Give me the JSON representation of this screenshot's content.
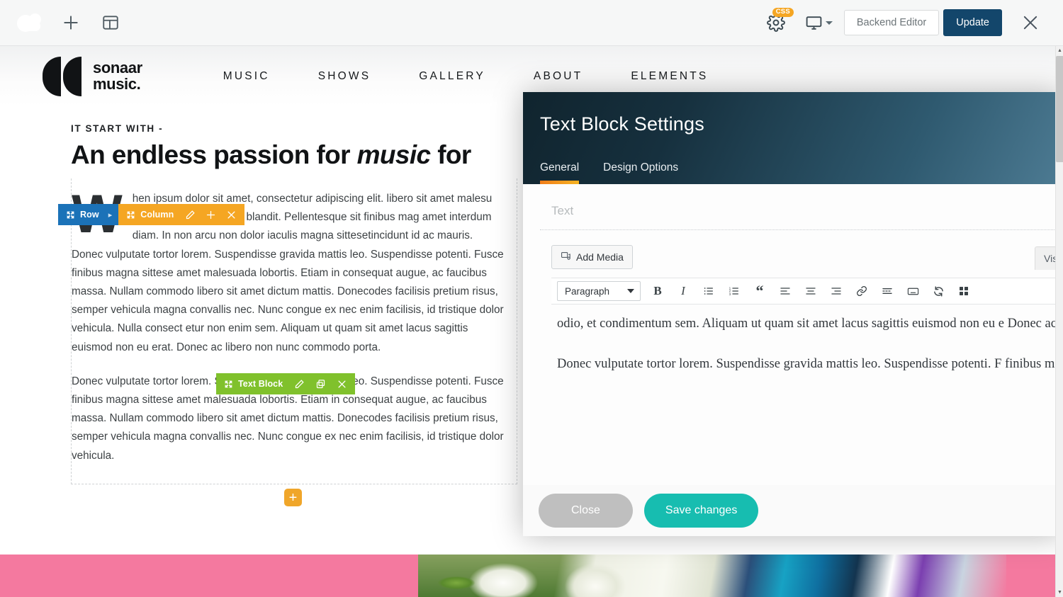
{
  "adminbar": {
    "logo_icon": "cloud-icon",
    "add_icon": "plus-icon",
    "templates_icon": "layout-template-icon",
    "settings_icon": "gear-icon",
    "css_badge": "CSS",
    "responsive_icon": "monitor-icon",
    "backend_editor_label": "Backend Editor",
    "update_label": "Update",
    "close_icon": "close-icon"
  },
  "site": {
    "brand": {
      "line1": "sonaar",
      "line2": "music."
    },
    "nav": [
      {
        "label": "MUSIC"
      },
      {
        "label": "SHOWS"
      },
      {
        "label": "GALLERY"
      },
      {
        "label": "ABOUT"
      },
      {
        "label": "ELEMENTS"
      }
    ],
    "eyebrow": "IT START WITH -",
    "headline_before": "An endless passion for ",
    "headline_italic": "music",
    "headline_after": " for",
    "dropcap": "W",
    "paragraph1": "hen ipsum dolor sit amet, consectetur adipiscing elit. libero sit amet malesu ada vitae nulla sit amet blandit. Pellentesque sit finibus mag amet interdum diam. In non arcu non dolor iaculis magna sittesetincidunt id ac mauris. Donec vulputate tortor lorem. Suspendisse gravida mattis leo. Suspendisse potenti. Fusce finibus magna sittese amet malesuada lobortis. Etiam in consequat augue, ac faucibus massa. Nullam commodo libero sit amet dictum mattis. Donecodes facilisis pretium risus, semper vehicula magna convallis nec. Nunc congue ex nec enim facilisis, id tristique dolor vehicula. Nulla consect etur non enim sem. Aliquam ut quam sit amet lacus sagittis euismod non eu erat. Donec ac libero non nunc commodo porta.",
    "paragraph2": "Donec vulputate tortor lorem. Suspendisse gravida mattis leo. Suspendisse potenti. Fusce finibus magna sittese amet malesuada lobortis. Etiam in consequat augue, ac faucibus massa. Nullam commodo libero sit amet dictum mattis. Donecodes facilisis pretium risus, semper vehicula magna convallis nec. Nunc congue ex nec enim facilisis, id tristique dolor vehicula.",
    "add_element_icon": "plus-icon"
  },
  "controls": {
    "row": {
      "label": "Row",
      "move_icon": "move-arrows-icon",
      "expand_icon": "chevron-right-icon",
      "color": "#1b72b8"
    },
    "column": {
      "label": "Column",
      "move_icon": "move-arrows-icon",
      "edit_icon": "pencil-icon",
      "add_icon": "plus-icon",
      "delete_icon": "close-icon",
      "color": "#f5a623"
    },
    "textblock": {
      "label": "Text Block",
      "move_icon": "move-arrows-icon",
      "edit_icon": "pencil-icon",
      "duplicate_icon": "copy-icon",
      "delete_icon": "close-icon",
      "color": "#80c12c"
    }
  },
  "modal": {
    "title": "Text Block Settings",
    "tabs": [
      {
        "label": "General",
        "active": true
      },
      {
        "label": "Design Options",
        "active": false
      }
    ],
    "field_label": "Text",
    "add_media_label": "Add Media",
    "add_media_icon": "media-icon",
    "visual_tab_label": "Visu",
    "format_select_value": "Paragraph",
    "toolbar_buttons": [
      {
        "icon": "bold-icon",
        "glyph": "B"
      },
      {
        "icon": "italic-icon",
        "glyph": "I"
      },
      {
        "icon": "bulleted-list-icon",
        "glyph": ""
      },
      {
        "icon": "numbered-list-icon",
        "glyph": ""
      },
      {
        "icon": "blockquote-icon",
        "glyph": "“"
      },
      {
        "icon": "align-left-icon",
        "glyph": ""
      },
      {
        "icon": "align-center-icon",
        "glyph": ""
      },
      {
        "icon": "align-right-icon",
        "glyph": ""
      },
      {
        "icon": "link-icon",
        "glyph": ""
      },
      {
        "icon": "read-more-icon",
        "glyph": ""
      },
      {
        "icon": "keyboard-toolbar-toggle-icon",
        "glyph": ""
      },
      {
        "icon": "undo-redo-icon",
        "glyph": ""
      },
      {
        "icon": "grid-icon",
        "glyph": ""
      }
    ],
    "editor_paragraph1": "odio, et condimentum sem. Aliquam ut quam sit amet lacus sagittis euismod non eu e Donec ac libero non nunc commodo porta.",
    "editor_paragraph2": "Donec vulputate tortor lorem. Suspendisse gravida mattis leo. Suspendisse potenti. F finibus magna sittese amet malesuada lobortis. Etiam in consequat augue, ac faucibus massa. Nullam commodo libero sit amet dictum mattis. Donecodes facilisis pretium ri semper vehicula magna convallis nec. Nunc congue ex nec enim facilisis, id tristique d vehicula.",
    "close_label": "Close",
    "save_label": "Save changes"
  },
  "scrollbar": {
    "up_icon": "chevron-up-icon",
    "down_icon": "chevron-down-icon"
  }
}
